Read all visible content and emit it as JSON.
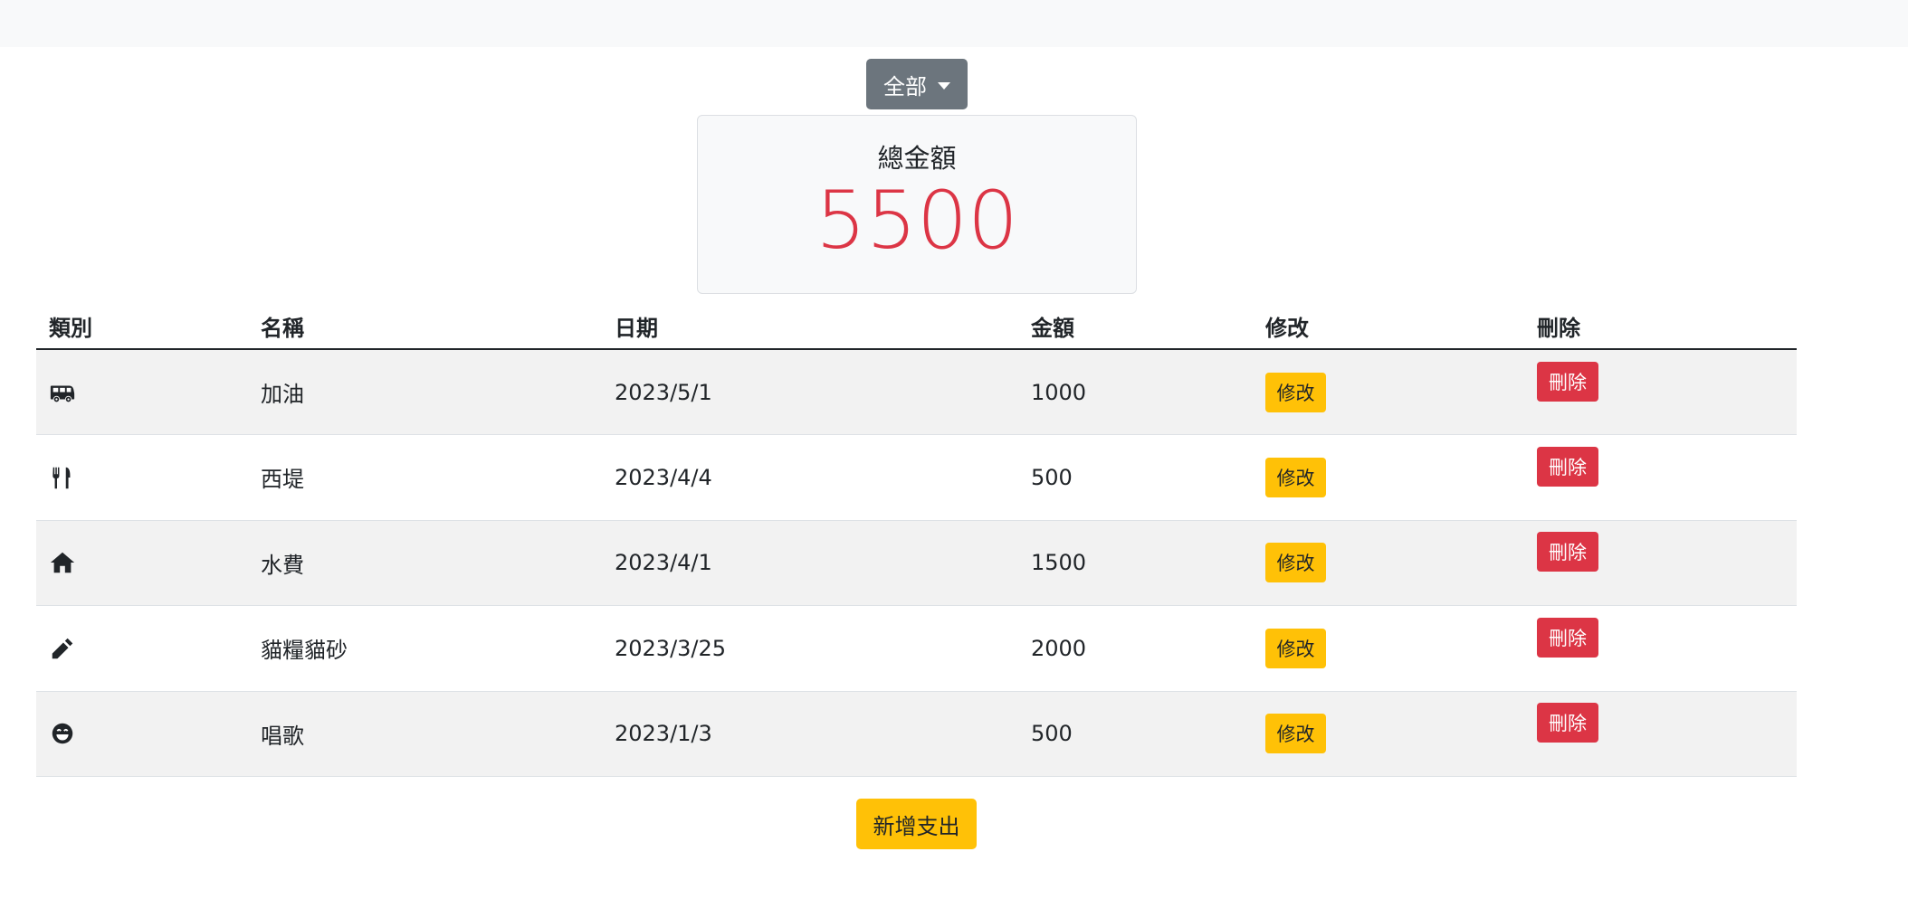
{
  "filter": {
    "label": "全部"
  },
  "summary": {
    "label": "總金額",
    "value": "5500"
  },
  "table": {
    "headers": {
      "category": "類別",
      "name": "名稱",
      "date": "日期",
      "amount": "金額",
      "edit": "修改",
      "delete": "刪除"
    },
    "rows": [
      {
        "icon": "van-icon",
        "name": "加油",
        "date": "2023/5/1",
        "amount": "1000",
        "edit_label": "修改",
        "delete_label": "刪除"
      },
      {
        "icon": "utensils-icon",
        "name": "西堤",
        "date": "2023/4/4",
        "amount": "500",
        "edit_label": "修改",
        "delete_label": "刪除"
      },
      {
        "icon": "home-icon",
        "name": "水費",
        "date": "2023/4/1",
        "amount": "1500",
        "edit_label": "修改",
        "delete_label": "刪除"
      },
      {
        "icon": "pencil-icon",
        "name": "貓糧貓砂",
        "date": "2023/3/25",
        "amount": "2000",
        "edit_label": "修改",
        "delete_label": "刪除"
      },
      {
        "icon": "smile-icon",
        "name": "唱歌",
        "date": "2023/1/3",
        "amount": "500",
        "edit_label": "修改",
        "delete_label": "刪除"
      }
    ]
  },
  "actions": {
    "add_label": "新增支出"
  },
  "colors": {
    "accent_warning": "#ffc107",
    "accent_danger": "#dc3545",
    "secondary": "#6c757d"
  }
}
